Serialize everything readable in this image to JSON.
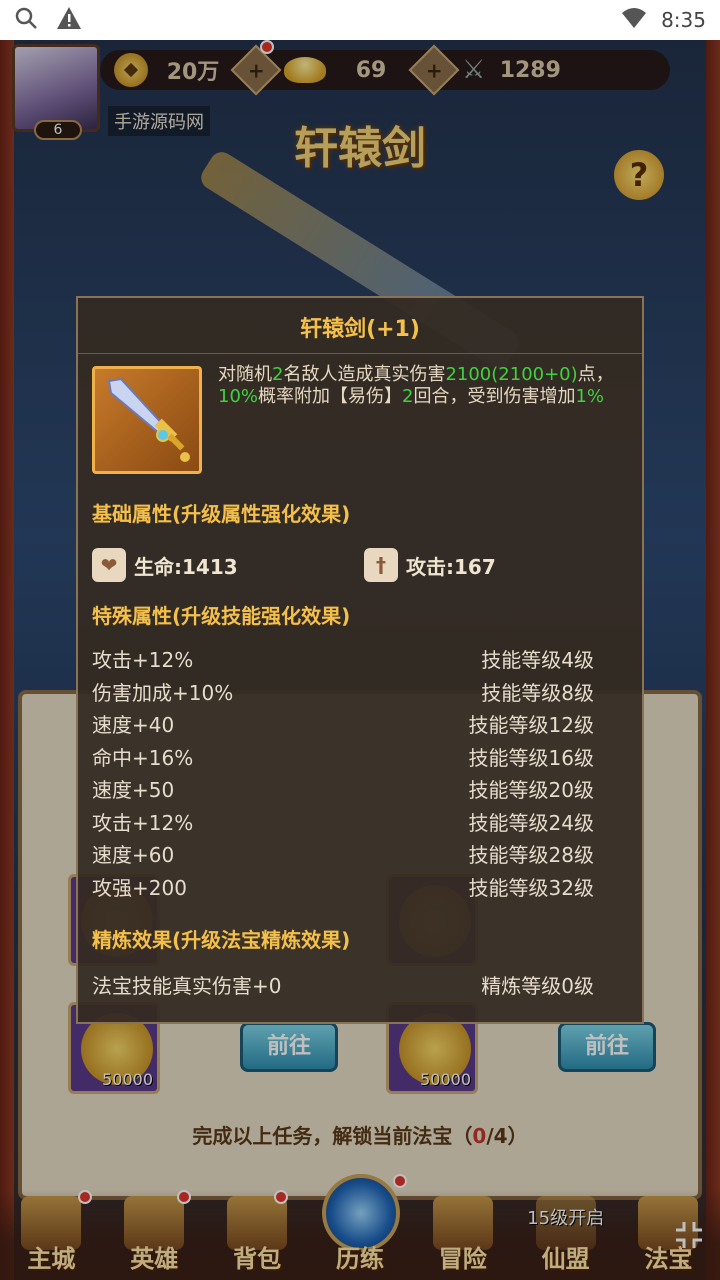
{
  "status_bar": {
    "time": "8:35"
  },
  "header": {
    "player_level": "6",
    "player_name": "手游源码网",
    "gold": "20万",
    "ingots": "69",
    "power": "1289",
    "page_title": "轩辕剑"
  },
  "background_tasks": {
    "unlock_text_prefix": "完成以上任务，解锁当前法宝（",
    "unlock_progress": "0",
    "unlock_text_suffix": "/4）",
    "go_button_1": "前往",
    "go_button_2": "前往",
    "reward_1": "50000",
    "reward_2": "50000"
  },
  "bottom_nav": {
    "items": [
      {
        "label": "主城"
      },
      {
        "label": "英雄"
      },
      {
        "label": "背包"
      },
      {
        "label": "历练"
      },
      {
        "label": "冒险"
      },
      {
        "label": "仙盟",
        "lock": "15级开启"
      },
      {
        "label": "法宝"
      }
    ]
  },
  "modal": {
    "title": "轩辕剑(+1)",
    "desc": {
      "p1": "对随机",
      "n1": "2",
      "p2": "名敌人造成真实伤害",
      "n2": "2100(2100+0)",
      "p3": "点，",
      "n3": "10%",
      "p4": "概率附加【易伤】",
      "n4": "2",
      "p5": "回合，受到伤害增加",
      "n5": "1%"
    },
    "base_title": "基础属性(升级属性强化效果)",
    "base_stats": [
      {
        "label": "生命:1413",
        "icon": "heart-shield-icon"
      },
      {
        "label": "攻击:167",
        "icon": "sword-shield-icon"
      }
    ],
    "special_title": "特殊属性(升级技能强化效果)",
    "special_rows": [
      {
        "attr": "攻击+12%",
        "req": "技能等级4级"
      },
      {
        "attr": "伤害加成+10%",
        "req": "技能等级8级"
      },
      {
        "attr": "速度+40",
        "req": "技能等级12级"
      },
      {
        "attr": "命中+16%",
        "req": "技能等级16级"
      },
      {
        "attr": "速度+50",
        "req": "技能等级20级"
      },
      {
        "attr": "攻击+12%",
        "req": "技能等级24级"
      },
      {
        "attr": "速度+60",
        "req": "技能等级28级"
      },
      {
        "attr": "攻强+200",
        "req": "技能等级32级"
      }
    ],
    "refine_title": "精炼效果(升级法宝精炼效果)",
    "refine_row": {
      "attr": "法宝技能真实伤害+0",
      "req": "精炼等级0级"
    }
  }
}
